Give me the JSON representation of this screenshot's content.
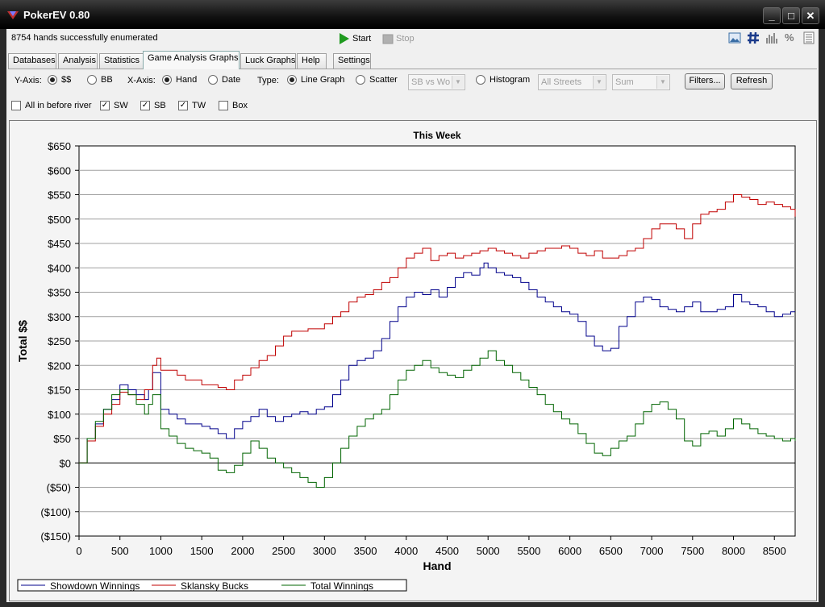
{
  "window": {
    "title": "PokerEV 0.80",
    "controls": [
      "_",
      "□",
      "✕"
    ]
  },
  "status_text": "8754 hands successfully enumerated",
  "toolbar": {
    "start_label": "Start",
    "stop_label": "Stop",
    "right_icons": [
      "image-icon",
      "hash-icon",
      "bar-chart-icon",
      "percent-icon",
      "document-icon"
    ],
    "percent_glyph": "%"
  },
  "tabs": [
    "Databases",
    "Analysis",
    "Statistics",
    "Game Analysis Graphs",
    "Luck Graphs",
    "Help",
    "Settings"
  ],
  "active_tab": "Game Analysis Graphs",
  "options": {
    "y_axis_label": "Y-Axis:",
    "y_options": [
      "$$",
      "BB"
    ],
    "y_selected": "$$",
    "x_axis_label": "X-Axis:",
    "x_options": [
      "Hand",
      "Date"
    ],
    "x_selected": "Hand",
    "type_label": "Type:",
    "type_options": [
      "Line Graph",
      "Scatter",
      "Histogram"
    ],
    "type_selected": "Line Graph",
    "scatter_select": "SB vs Wo",
    "streets_select": "All Streets",
    "agg_select": "Sum",
    "filters_button": "Filters...",
    "refresh_button": "Refresh",
    "checkboxes": [
      {
        "label": "All in before river",
        "checked": false
      },
      {
        "label": "SW",
        "checked": true
      },
      {
        "label": "SB",
        "checked": true
      },
      {
        "label": "TW",
        "checked": true
      },
      {
        "label": "Box",
        "checked": false
      }
    ]
  },
  "chart_data": {
    "type": "line",
    "title": "This Week",
    "xlabel": "Hand",
    "ylabel": "Total $$",
    "xlim": [
      0,
      8754
    ],
    "ylim": [
      -150,
      650
    ],
    "x_ticks": [
      0,
      500,
      1000,
      1500,
      2000,
      2500,
      3000,
      3500,
      4000,
      4500,
      5000,
      5500,
      6000,
      6500,
      7000,
      7500,
      8000,
      8500
    ],
    "y_ticks": [
      -150,
      -100,
      -50,
      0,
      50,
      100,
      150,
      200,
      250,
      300,
      350,
      400,
      450,
      500,
      550,
      600,
      650
    ],
    "y_tick_labels": [
      "($150)",
      "($100)",
      "($50)",
      "$0",
      "$50",
      "$100",
      "$150",
      "$200",
      "$250",
      "$300",
      "$350",
      "$400",
      "$450",
      "$500",
      "$550",
      "$600",
      "$650"
    ],
    "grid": "horizontal",
    "legend": "bottom-left",
    "series": [
      {
        "name": "Showdown Winnings",
        "color": "#00008b",
        "x": [
          0,
          100,
          200,
          300,
          400,
          500,
          600,
          700,
          800,
          850,
          900,
          1000,
          1100,
          1200,
          1300,
          1500,
          1600,
          1700,
          1800,
          1900,
          2000,
          2100,
          2200,
          2300,
          2400,
          2500,
          2600,
          2700,
          2800,
          2900,
          3000,
          3100,
          3200,
          3300,
          3400,
          3500,
          3600,
          3700,
          3800,
          3900,
          4000,
          4100,
          4200,
          4300,
          4400,
          4500,
          4600,
          4700,
          4800,
          4900,
          4950,
          5000,
          5100,
          5200,
          5300,
          5400,
          5500,
          5600,
          5700,
          5800,
          5900,
          6000,
          6100,
          6200,
          6300,
          6400,
          6500,
          6600,
          6700,
          6800,
          6900,
          7000,
          7100,
          7200,
          7300,
          7400,
          7500,
          7600,
          7700,
          7800,
          7900,
          8000,
          8100,
          8200,
          8300,
          8400,
          8500,
          8600,
          8700,
          8754
        ],
        "y": [
          0,
          50,
          80,
          110,
          130,
          160,
          150,
          140,
          130,
          150,
          185,
          110,
          100,
          90,
          80,
          75,
          70,
          60,
          50,
          70,
          85,
          95,
          110,
          95,
          85,
          95,
          100,
          105,
          100,
          110,
          115,
          140,
          170,
          200,
          210,
          215,
          230,
          255,
          290,
          320,
          340,
          350,
          345,
          355,
          340,
          360,
          380,
          390,
          385,
          400,
          410,
          400,
          390,
          385,
          380,
          370,
          355,
          340,
          330,
          320,
          310,
          305,
          290,
          260,
          240,
          230,
          235,
          280,
          300,
          330,
          340,
          335,
          320,
          315,
          310,
          320,
          330,
          310,
          310,
          315,
          320,
          345,
          330,
          325,
          320,
          310,
          300,
          305,
          310,
          310
        ]
      },
      {
        "name": "Sklansky Bucks",
        "color": "#c00000",
        "x": [
          0,
          100,
          200,
          300,
          400,
          500,
          600,
          700,
          800,
          900,
          950,
          1000,
          1200,
          1300,
          1500,
          1600,
          1700,
          1800,
          1900,
          2000,
          2100,
          2200,
          2300,
          2400,
          2500,
          2600,
          2700,
          2800,
          2900,
          3000,
          3100,
          3200,
          3300,
          3400,
          3500,
          3600,
          3700,
          3800,
          3900,
          4000,
          4100,
          4200,
          4300,
          4400,
          4500,
          4600,
          4700,
          4800,
          4900,
          5000,
          5100,
          5200,
          5300,
          5400,
          5500,
          5600,
          5700,
          5800,
          5900,
          6000,
          6100,
          6200,
          6300,
          6400,
          6500,
          6600,
          6700,
          6800,
          6900,
          7000,
          7100,
          7200,
          7300,
          7400,
          7500,
          7600,
          7700,
          7800,
          7900,
          8000,
          8100,
          8200,
          8300,
          8400,
          8500,
          8600,
          8700,
          8754
        ],
        "y": [
          0,
          45,
          75,
          100,
          120,
          145,
          140,
          130,
          150,
          200,
          215,
          190,
          180,
          170,
          160,
          160,
          155,
          150,
          170,
          180,
          195,
          210,
          220,
          240,
          260,
          270,
          270,
          275,
          275,
          285,
          300,
          310,
          330,
          340,
          345,
          355,
          370,
          380,
          400,
          420,
          430,
          440,
          415,
          425,
          430,
          420,
          425,
          430,
          435,
          440,
          435,
          430,
          425,
          420,
          430,
          435,
          440,
          440,
          445,
          440,
          430,
          425,
          435,
          420,
          420,
          425,
          435,
          440,
          460,
          480,
          490,
          490,
          480,
          460,
          490,
          510,
          515,
          520,
          535,
          550,
          545,
          540,
          530,
          535,
          530,
          525,
          520,
          505
        ]
      },
      {
        "name": "Total Winnings",
        "color": "#006400",
        "x": [
          0,
          100,
          200,
          300,
          400,
          500,
          600,
          700,
          800,
          850,
          900,
          1000,
          1100,
          1200,
          1300,
          1400,
          1500,
          1600,
          1700,
          1800,
          1900,
          2000,
          2100,
          2200,
          2300,
          2400,
          2500,
          2600,
          2700,
          2800,
          2900,
          3000,
          3100,
          3200,
          3300,
          3400,
          3500,
          3600,
          3700,
          3800,
          3900,
          4000,
          4100,
          4200,
          4300,
          4400,
          4500,
          4600,
          4700,
          4800,
          4900,
          5000,
          5100,
          5200,
          5300,
          5400,
          5500,
          5600,
          5700,
          5800,
          5900,
          6000,
          6100,
          6200,
          6300,
          6400,
          6500,
          6600,
          6700,
          6800,
          6900,
          7000,
          7100,
          7200,
          7300,
          7400,
          7500,
          7600,
          7700,
          7800,
          7900,
          8000,
          8100,
          8200,
          8300,
          8400,
          8500,
          8600,
          8700,
          8754
        ],
        "y": [
          0,
          50,
          85,
          110,
          140,
          150,
          140,
          120,
          100,
          120,
          140,
          70,
          55,
          40,
          30,
          25,
          20,
          10,
          -15,
          -20,
          -5,
          20,
          45,
          30,
          10,
          0,
          -10,
          -20,
          -30,
          -40,
          -50,
          -30,
          0,
          30,
          55,
          75,
          90,
          100,
          110,
          140,
          170,
          190,
          200,
          210,
          195,
          185,
          180,
          175,
          190,
          200,
          215,
          230,
          210,
          200,
          185,
          170,
          155,
          140,
          120,
          105,
          90,
          80,
          60,
          40,
          20,
          15,
          30,
          45,
          55,
          80,
          105,
          120,
          125,
          110,
          90,
          45,
          35,
          60,
          65,
          55,
          70,
          90,
          80,
          70,
          60,
          55,
          50,
          45,
          50,
          45
        ]
      }
    ]
  }
}
